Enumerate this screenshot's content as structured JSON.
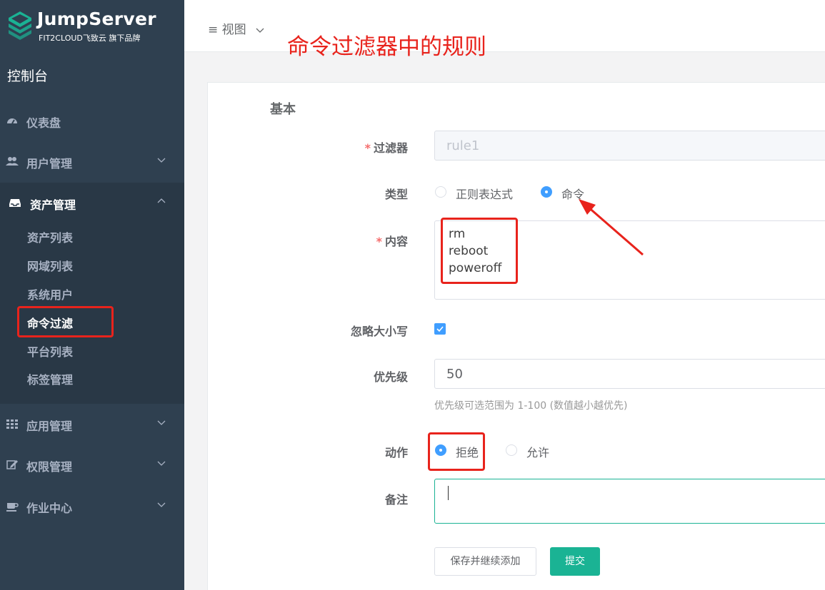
{
  "sidebar": {
    "logo_title": "JumpServer",
    "logo_subtitle": "FIT2CLOUD飞致云 旗下品牌",
    "console_title": "控制台",
    "items": [
      {
        "label": "仪表盘",
        "icon": "dashboard-icon"
      },
      {
        "label": "用户管理",
        "icon": "users-icon"
      },
      {
        "label": "资产管理",
        "icon": "inbox-icon",
        "expanded": true,
        "children": [
          "资产列表",
          "网域列表",
          "系统用户",
          "命令过滤",
          "平台列表",
          "标签管理"
        ],
        "active_child": "命令过滤"
      },
      {
        "label": "应用管理",
        "icon": "grid-icon"
      },
      {
        "label": "权限管理",
        "icon": "edit-icon"
      },
      {
        "label": "作业中心",
        "icon": "coffee-icon"
      }
    ]
  },
  "topbar": {
    "view_label": "视图"
  },
  "annotation": {
    "title": "命令过滤器中的规则"
  },
  "form": {
    "section_title": "基本",
    "filter_label": "过滤器",
    "filter_value": "rule1",
    "type_label": "类型",
    "type_options": [
      "正则表达式",
      "命令"
    ],
    "type_selected": "命令",
    "content_label": "内容",
    "content_lines": [
      "rm",
      "reboot",
      "poweroff"
    ],
    "ignore_case_label": "忽略大小写",
    "ignore_case_checked": true,
    "priority_label": "优先级",
    "priority_value": "50",
    "priority_hint": "优先级可选范围为 1-100 (数值越小越优先)",
    "action_label": "动作",
    "action_options": [
      "拒绝",
      "允许"
    ],
    "action_selected": "拒绝",
    "comment_label": "备注",
    "comment_value": "",
    "save_continue_label": "保存并继续添加",
    "submit_label": "提交"
  },
  "colors": {
    "sidebar_bg": "#2f4050",
    "sidebar_active_bg": "#293846",
    "primary": "#1ab394",
    "radio_blue": "#409eff",
    "annotation_red": "#e8231c"
  }
}
